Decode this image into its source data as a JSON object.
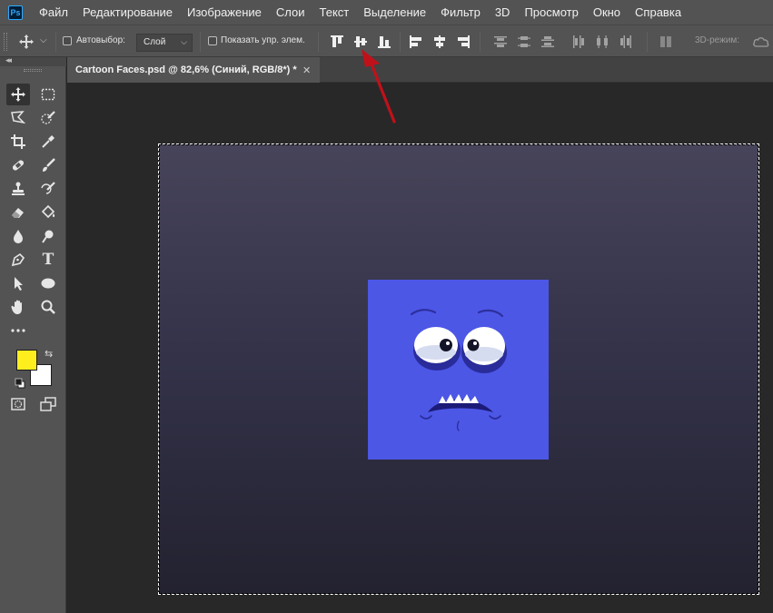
{
  "app": {
    "logo_text": "Ps"
  },
  "menu": {
    "items": [
      "Файл",
      "Редактирование",
      "Изображение",
      "Слои",
      "Текст",
      "Выделение",
      "Фильтр",
      "3D",
      "Просмотр",
      "Окно",
      "Справка"
    ]
  },
  "options": {
    "auto_select_label": "Автовыбор:",
    "auto_select_checked": false,
    "layer_select_value": "Слой",
    "show_transform_label": "Показать упр. элем.",
    "show_transform_checked": false,
    "mode_3d_label": "3D-режим:"
  },
  "document": {
    "tab_title": "Cartoon Faces.psd @ 82,6% (Синий, RGB/8*) *",
    "canvas_gradient_top": "#47445a",
    "canvas_gradient_bottom": "#232230",
    "layer_color": "#4c57e6"
  },
  "tools": {
    "active": "move-tool"
  },
  "colors": {
    "foreground": "#ffee1e",
    "background": "#ffffff",
    "annotation_arrow": "#c0111a"
  }
}
